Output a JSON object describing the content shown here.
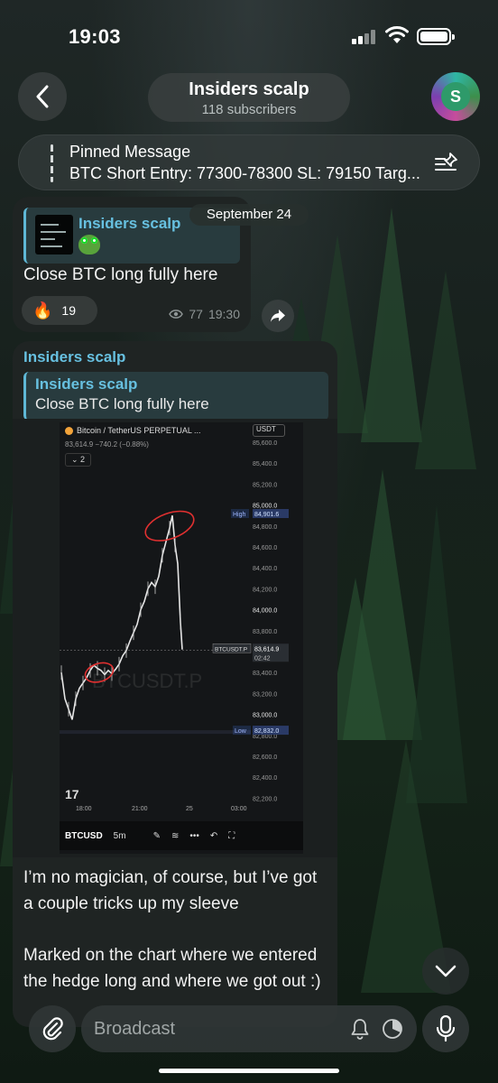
{
  "status_bar": {
    "time": "19:03"
  },
  "header": {
    "channel_name": "Insiders scalp",
    "subscribers": "118 subscribers",
    "avatar_letter": "S"
  },
  "pinned": {
    "label": "Pinned Message",
    "text": "BTC Short Entry: 77300-78300 SL: 79150 Targ..."
  },
  "date_separator": "September 24",
  "messages": [
    {
      "reply_name": "Insiders scalp",
      "text": "Close BTC long fully here",
      "reaction": {
        "emoji": "🔥",
        "count": "19"
      },
      "views": "77",
      "time": "19:30"
    },
    {
      "sender": "Insiders scalp",
      "reply": {
        "name": "Insiders scalp",
        "text": "Close BTC long fully here"
      },
      "chart_image": {
        "symbol": "Bitcoin / TetherUS PERPETUAL ...",
        "quote": "83,614.9 −740.2 (−0.88%)",
        "indicators_count": "2",
        "currency": "USDT",
        "watermark": "BTCUSDT.P",
        "price_labels": [
          "85,600.0",
          "85,400.0",
          "85,200.0",
          "85,000.0",
          "84,800.0",
          "84,600.0",
          "84,400.0",
          "84,200.0",
          "84,000.0",
          "83,800.0",
          "83,600.0",
          "83,400.0",
          "83,200.0",
          "83,000.0",
          "82,800.0",
          "82,600.0",
          "82,400.0",
          "82,200.0"
        ],
        "high": {
          "label": "High",
          "value": "84,901.6"
        },
        "low": {
          "label": "Low",
          "value": "82,832.0"
        },
        "current": {
          "label": "BTCUSDT.P",
          "value": "83,614.9",
          "countdown": "02:42"
        },
        "time_labels": [
          "18:00",
          "21:00",
          "25",
          "03:00"
        ],
        "toolbar": {
          "symbol": "BTCUSD",
          "interval": "5m",
          "more": "•••"
        }
      },
      "body_paragraphs": [
        "I’m no magician, of course, but I’ve got a couple tricks up my sleeve",
        "Marked on the chart where we entered the hedge long and where we got out :)"
      ]
    }
  ],
  "composer": {
    "placeholder": "Broadcast"
  }
}
